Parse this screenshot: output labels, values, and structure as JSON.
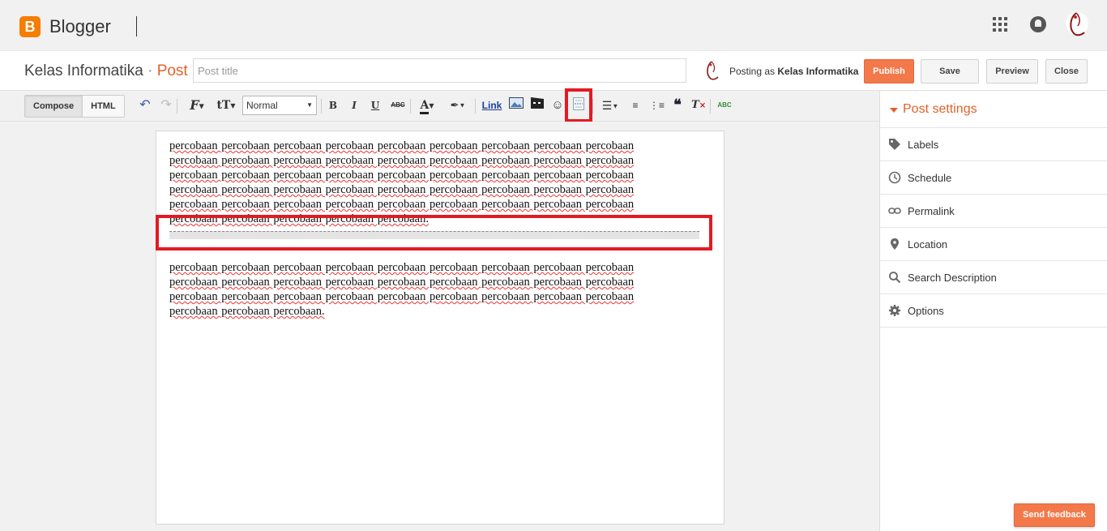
{
  "header": {
    "logo_letter": "B",
    "app_name": "Blogger",
    "icons": [
      "apps-grid-icon",
      "notifications-icon",
      "account-avatar-icon"
    ]
  },
  "titlebar": {
    "blog_name": "Kelas Informatika",
    "separator": "·",
    "section": "Post",
    "post_title_placeholder": "Post title",
    "post_title_value": "",
    "posting_as_label": "Posting as",
    "posting_as_name": "Kelas Informatika",
    "buttons": {
      "publish": "Publish",
      "save": "Save",
      "preview": "Preview",
      "close": "Close"
    }
  },
  "toolbar": {
    "tabs": [
      {
        "label": "Compose",
        "active": true
      },
      {
        "label": "HTML",
        "active": false
      }
    ],
    "format_select": "Normal",
    "link_label": "Link",
    "icons": [
      "undo-icon",
      "redo-icon",
      "font-family-icon",
      "font-size-icon",
      "bold-icon",
      "italic-icon",
      "underline-icon",
      "strikethrough-icon",
      "text-color-icon",
      "highlight-color-icon",
      "link-icon",
      "insert-image-icon",
      "insert-video-icon",
      "insert-emoji-icon",
      "insert-jump-break-icon",
      "alignment-icon",
      "numbered-list-icon",
      "bulleted-list-icon",
      "quote-icon",
      "remove-formatting-icon",
      "spell-check-icon"
    ],
    "glyphs": {
      "bold": "B",
      "italic": "I",
      "underline": "U",
      "strike": "ABC",
      "textcolor": "A",
      "quote": "❝",
      "clear": "T",
      "spell": "ABC"
    }
  },
  "editor": {
    "paragraph1": "percobaan percobaan percobaan percobaan percobaan percobaan percobaan percobaan percobaan percobaan percobaan percobaan percobaan percobaan percobaan percobaan percobaan percobaan percobaan percobaan percobaan percobaan percobaan percobaan percobaan percobaan percobaan percobaan percobaan percobaan percobaan percobaan percobaan percobaan percobaan percobaan percobaan percobaan percobaan percobaan percobaan percobaan percobaan percobaan percobaan percobaan percobaan percobaan percobaan percobaan.",
    "paragraph2": "percobaan percobaan percobaan percobaan percobaan percobaan percobaan percobaan percobaan percobaan percobaan percobaan percobaan percobaan percobaan percobaan percobaan percobaan percobaan percobaan percobaan percobaan percobaan percobaan percobaan percobaan percobaan percobaan percobaan percobaan."
  },
  "sidebar": {
    "title": "Post settings",
    "items": [
      {
        "label": "Labels",
        "icon": "label-tag-icon"
      },
      {
        "label": "Schedule",
        "icon": "clock-icon"
      },
      {
        "label": "Permalink",
        "icon": "link-chain-icon"
      },
      {
        "label": "Location",
        "icon": "location-pin-icon"
      },
      {
        "label": "Search Description",
        "icon": "search-icon"
      },
      {
        "label": "Options",
        "icon": "gear-icon"
      }
    ]
  },
  "feedback_button": "Send feedback",
  "colors": {
    "accent": "#f3784a",
    "highlight_red": "#e21b23",
    "brand_orange": "#f57d00"
  }
}
